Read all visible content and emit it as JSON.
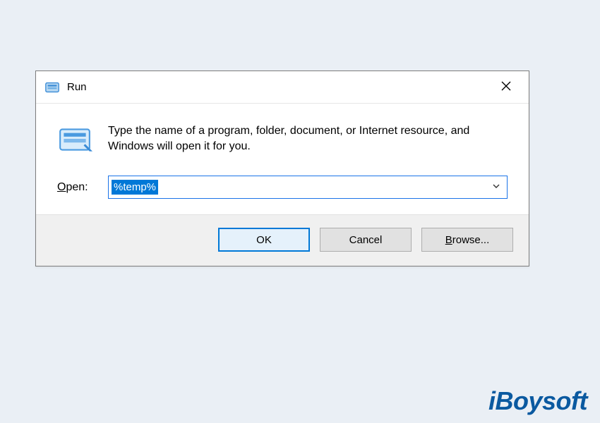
{
  "dialog": {
    "title": "Run",
    "description": "Type the name of a program, folder, document, or Internet resource, and Windows will open it for you.",
    "open_label_underline": "O",
    "open_label_rest": "pen:",
    "input_value": "%temp%",
    "buttons": {
      "ok": "OK",
      "cancel": "Cancel",
      "browse_underline": "B",
      "browse_rest": "rowse..."
    }
  },
  "watermark": "iBoysoft"
}
